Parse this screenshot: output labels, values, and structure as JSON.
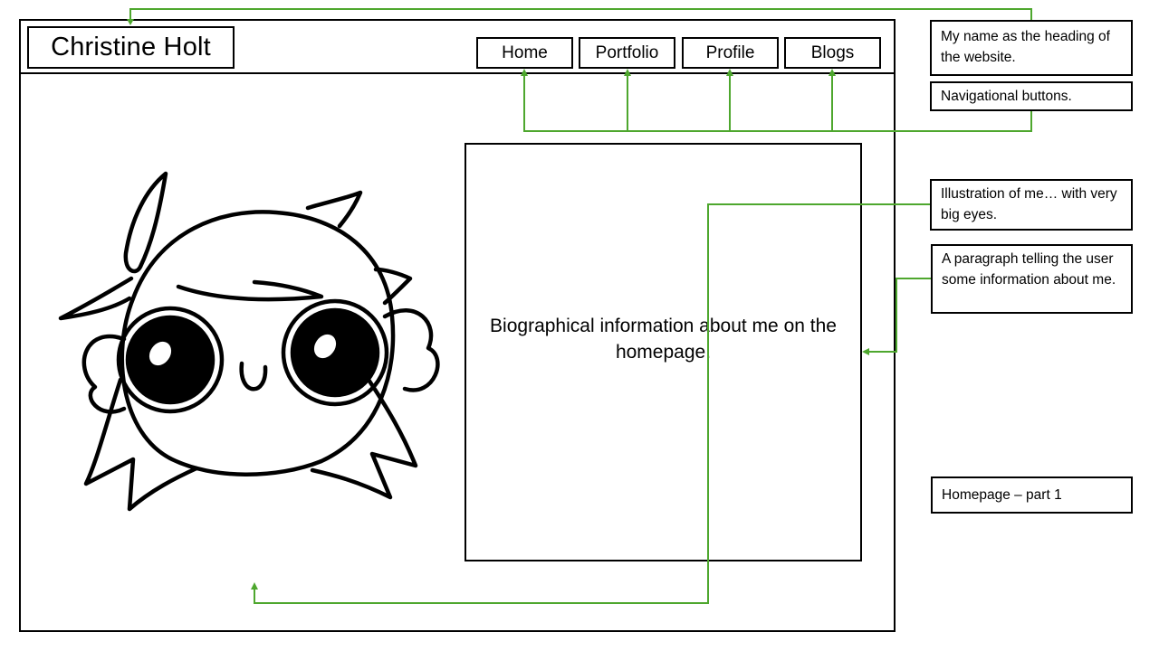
{
  "site": {
    "title": "Christine Holt",
    "nav": [
      "Home",
      "Portfolio",
      "Profile",
      "Blogs"
    ],
    "bio_text": "Biographical information about me on the homepage."
  },
  "annotations": {
    "heading_note": "My name as the heading of the website.",
    "nav_note": "Navigational buttons.",
    "illustration_note": "Illustration of me… with very big eyes.",
    "paragraph_note": "A paragraph telling the user some information about me.",
    "page_label": "Homepage – part 1"
  },
  "colors": {
    "arrow": "#4ea72e",
    "outline": "#000000"
  },
  "icons": {
    "illustration": "cartoon-self-portrait-icon"
  }
}
